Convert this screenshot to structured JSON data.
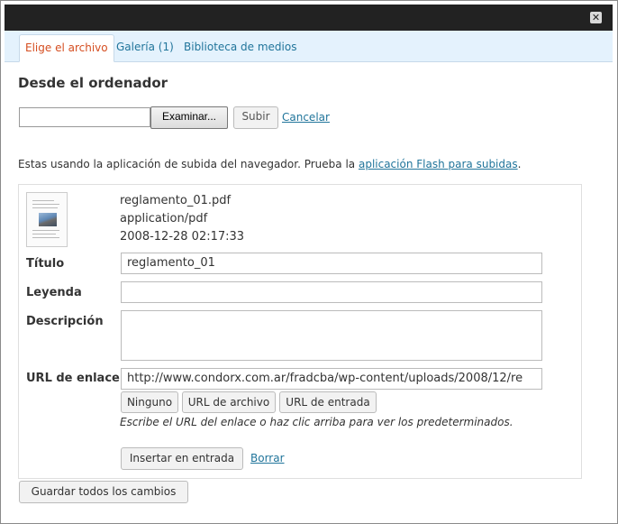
{
  "window": {
    "close_glyph": "✕"
  },
  "tabs": [
    {
      "label": "Elige el archivo",
      "active": true
    },
    {
      "label": "Galería (1)",
      "active": false
    },
    {
      "label": "Biblioteca de medios",
      "active": false
    }
  ],
  "upload": {
    "heading": "Desde el ordenador",
    "file_value": "",
    "browse_label": "Examinar...",
    "submit_label": "Subir",
    "cancel_label": "Cancelar"
  },
  "notice": {
    "text": "Estas usando la aplicación de subida del navegador. Prueba la ",
    "link": "aplicación Flash para subidas",
    "end": "."
  },
  "attachment": {
    "thumbnail_icon": "pdf-document-icon",
    "filename": "reglamento_01.pdf",
    "mime": "application/pdf",
    "date": "2008-12-28 02:17:33",
    "title_label": "Título",
    "title_value": "reglamento_01",
    "caption_label": "Leyenda",
    "caption_value": "",
    "description_label": "Descripción",
    "description_value": "",
    "url_label": "URL de enlace",
    "url_value": "http://www.condorx.com.ar/fradcba/wp-content/uploads/2008/12/re",
    "btn_none": "Ninguno",
    "btn_file_url": "URL de archivo",
    "btn_post_url": "URL de entrada",
    "url_hint": "Escribe el URL del enlace o haz clic arriba para ver los predeterminados.",
    "insert_label": "Insertar en entrada",
    "delete_label": "Borrar"
  },
  "footer": {
    "save_all_label": "Guardar todos los cambios"
  },
  "colors": {
    "accent_link": "#21759b",
    "active_tab": "#d54e21",
    "tabbar_bg": "#e4f2fd",
    "titlebar_bg": "#222222"
  }
}
